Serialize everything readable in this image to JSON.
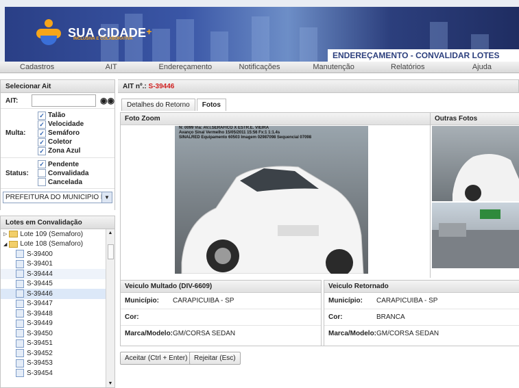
{
  "header": {
    "logo_text": "SUA CIDADE",
    "logo_plus": "+",
    "logo_subtitle": "INCLUSIVA E COLABORATIVA",
    "section_title": "ENDEREÇAMENTO - CONVALIDAR LOTES"
  },
  "menu": [
    "Cadastros",
    "AIT",
    "Endereçamento",
    "Notificações",
    "Manutenção",
    "Relatórios",
    "Ajuda"
  ],
  "filters": {
    "title": "Selecionar Ait",
    "ait_label": "AIT:",
    "ait_value": "",
    "multa_label": "Multa:",
    "multa_options": [
      "Talão",
      "Velocidade",
      "Semáforo",
      "Coletor",
      "Zona Azul"
    ],
    "status_label": "Status:",
    "status_options": [
      {
        "label": "Pendente",
        "checked": true
      },
      {
        "label": "Convalidada",
        "checked": false
      },
      {
        "label": "Cancelada",
        "checked": false
      }
    ],
    "org_select": "PREFEITURA DO MUNICIPIO D"
  },
  "lotes": {
    "title": "Lotes em Convalidação",
    "folders": [
      "Lote 109 (Semaforo)",
      "Lote 108 (Semaforo)"
    ],
    "items": [
      "S-39400",
      "S-39401",
      "S-39444",
      "S-39445",
      "S-39446",
      "S-39447",
      "S-39448",
      "S-39449",
      "S-39450",
      "S-39451",
      "S-39452",
      "S-39453",
      "S-39454"
    ],
    "selected": "S-39446"
  },
  "main": {
    "ait_label": "AIT nº.:",
    "ait_number": "S-39446",
    "tabs": [
      "Detalhes do Retorno",
      "Fotos"
    ],
    "foto_zoom_title": "Foto Zoom",
    "outras_fotos_title": "Outras Fotos",
    "photo_overlay": [
      "N: 0099 Via: AV.I.SERAFICO X ESTR.E. VIEIRA",
      "Avanço Sinal Vermelho 15/05/2011 15:56 Fx:1 1:1.4s",
      "SINALRED Equipamento 60503 Imagem 02987098 Sequencial 07098"
    ]
  },
  "veiculo_multado": {
    "title": "Veiculo Multado (DIV-6609)",
    "municipio_label": "Município:",
    "municipio": "CARAPICUIBA - SP",
    "cor_label": "Cor:",
    "cor": "",
    "marca_label": "Marca/Modelo:",
    "marca": "GM/CORSA SEDAN"
  },
  "veiculo_retornado": {
    "title": "Veiculo Retornado",
    "municipio_label": "Município:",
    "municipio": "CARAPICUIBA - SP",
    "cor_label": "Cor:",
    "cor": "BRANCA",
    "marca_label": "Marca/Modelo:",
    "marca": "GM/CORSA SEDAN"
  },
  "actions": {
    "accept": "Aceitar (Ctrl + Enter)",
    "reject": "Rejeitar (Esc)"
  }
}
